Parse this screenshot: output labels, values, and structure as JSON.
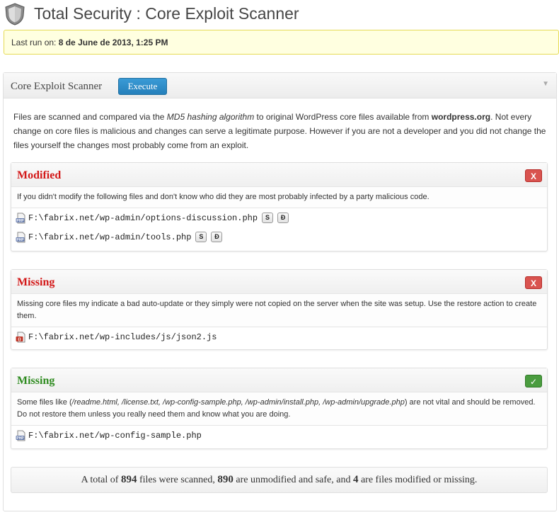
{
  "header": {
    "title": "Total Security : Core Exploit Scanner",
    "logo_icon": "shield-icon"
  },
  "notice": {
    "label": "Last run on:",
    "value": "8 de June de 2013, 1:25 PM"
  },
  "scanner": {
    "title": "Core Exploit Scanner",
    "execute_label": "Execute",
    "toggle_icon": "triangle-down-icon",
    "intro": {
      "p1": "Files are scanned and compared via the ",
      "md5": "MD5 hashing algorithm",
      "p2": " to original WordPress core files available from ",
      "site": "wordpress.org",
      "p3": ". Not every change on core files is malicious and changes can serve a legitimate purpose. However if you are not a developer and you did not change the files yourself the changes most probably come from an exploit."
    }
  },
  "sections": {
    "modified": {
      "title": "Modified",
      "badge": "X",
      "description": "If you didn't modify the following files and don't know who did they are most probably infected by a party malicious code.",
      "files": [
        {
          "path": "F:\\fabrix.net/wp-admin/options-discussion.php",
          "btn_s": "S",
          "btn_d": "Đ",
          "icon": "php-file-icon"
        },
        {
          "path": "F:\\fabrix.net/wp-admin/tools.php",
          "btn_s": "S",
          "btn_d": "Đ",
          "icon": "php-file-icon"
        }
      ]
    },
    "missing": {
      "title": "Missing",
      "badge": "X",
      "description": "Missing core files my indicate a bad auto-update or they simply were not copied on the server when the site was setup. Use the restore action to create them.",
      "files": [
        {
          "path": "F:\\fabrix.net/wp-includes/js/json2.js",
          "icon": "js-file-icon"
        }
      ]
    },
    "missing_ok": {
      "title": "Missing",
      "badge": "✓",
      "description_pre": "Some files like (",
      "description_files": "/readme.html, /license.txt, /wp-config-sample.php, /wp-admin/install.php, /wp-admin/upgrade.php",
      "description_post": ") are not vital and should be removed. Do not restore them unless you really need them and know what you are doing.",
      "files": [
        {
          "path": "F:\\fabrix.net/wp-config-sample.php",
          "icon": "php-file-icon"
        }
      ]
    }
  },
  "summary": {
    "t1": "A total of ",
    "total": "894",
    "t2": " files were scanned, ",
    "safe": "890",
    "t3": " are unmodified and safe, and ",
    "bad": "4",
    "t4": " are files modified or missing."
  },
  "colors": {
    "accent_blue": "#2580bb",
    "danger_red": "#d31818",
    "success_green": "#2e8b1f",
    "notice_bg": "#ffffe0"
  }
}
